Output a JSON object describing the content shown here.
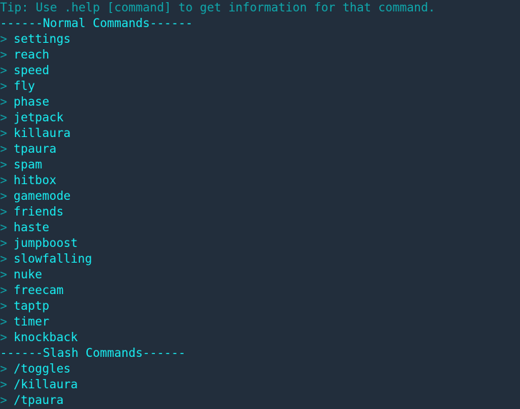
{
  "tip": "Tip: Use .help [command] to get information for that command.",
  "sections": [
    {
      "header": "------Normal Commands------",
      "arrow_icon": ">",
      "commands": [
        "settings",
        "reach",
        "speed",
        "fly",
        "phase",
        "jetpack",
        "killaura",
        "tpaura",
        "spam",
        "hitbox",
        "gamemode",
        "friends",
        "haste",
        "jumpboost",
        "slowfalling",
        "nuke",
        "freecam",
        "taptp",
        "timer",
        "knockback"
      ]
    },
    {
      "header": "------Slash Commands------",
      "arrow_icon": ">",
      "commands": [
        "/toggles",
        "/killaura",
        "/tpaura"
      ]
    }
  ],
  "colors": {
    "background": "#222e3c",
    "tip": "#0fa9ad",
    "header": "#19eef2",
    "command": "#19eef2",
    "arrow": "#0ea2a8"
  }
}
